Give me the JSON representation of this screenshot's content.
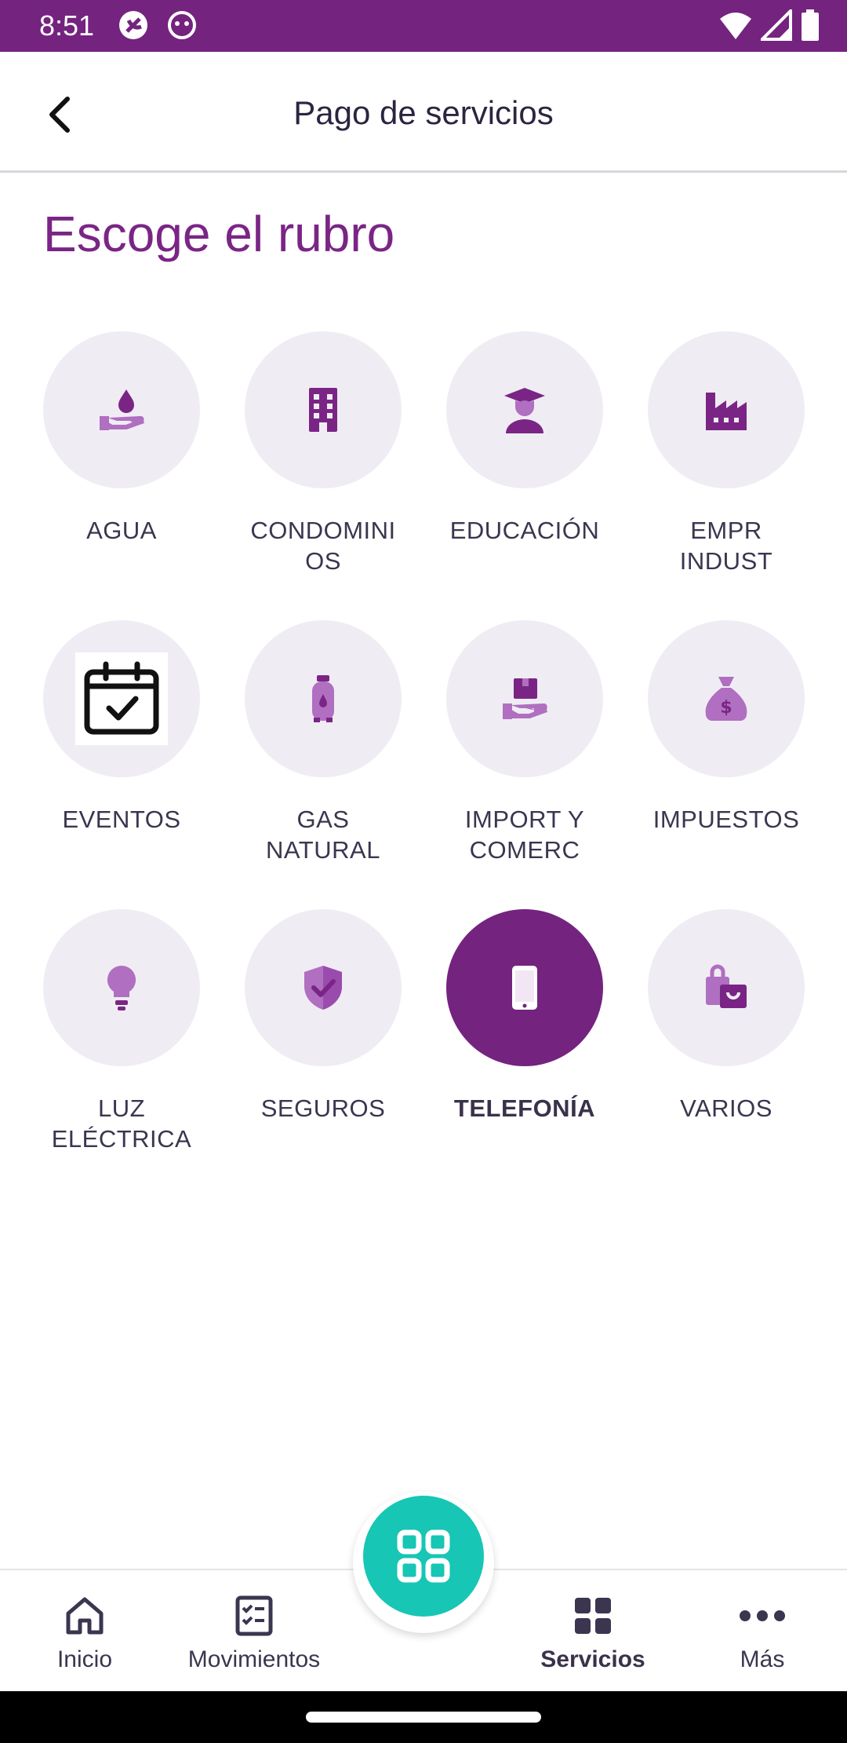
{
  "status_bar": {
    "time": "8:51",
    "icons": [
      "app-icon-1",
      "app-icon-2",
      "wifi-icon",
      "signal-icon",
      "battery-icon"
    ]
  },
  "header": {
    "title": "Pago de servicios",
    "back_icon": "chevron-left-icon"
  },
  "heading": "Escoge el rubro",
  "categories": [
    {
      "label": "AGUA",
      "icon": "water-hand-icon"
    },
    {
      "label": "CONDOMINI\nOS",
      "icon": "building-icon"
    },
    {
      "label": "EDUCACIÓN",
      "icon": "graduate-icon"
    },
    {
      "label": "EMPR\nINDUST",
      "icon": "factory-icon"
    },
    {
      "label": "EVENTOS",
      "icon": "calendar-check-icon"
    },
    {
      "label": "GAS\nNATURAL",
      "icon": "gas-cylinder-icon"
    },
    {
      "label": "IMPORT Y\nCOMERC",
      "icon": "package-hand-icon"
    },
    {
      "label": "IMPUESTOS",
      "icon": "money-bag-icon"
    },
    {
      "label": "LUZ\nELÉCTRICA",
      "icon": "lightbulb-icon"
    },
    {
      "label": "SEGUROS",
      "icon": "shield-check-icon"
    },
    {
      "label": "TELEFONÍA",
      "icon": "smartphone-icon",
      "selected": true
    },
    {
      "label": "VARIOS",
      "icon": "shopping-bag-icon"
    }
  ],
  "bottom_nav": {
    "items": [
      {
        "label": "Inicio",
        "icon": "home-icon"
      },
      {
        "label": "Movimientos",
        "icon": "checklist-icon"
      },
      {
        "label": "Servicios",
        "icon": "grid-icon",
        "active": true
      },
      {
        "label": "Más",
        "icon": "more-dots-icon"
      }
    ],
    "fab_icon": "qr-grid-icon"
  },
  "colors": {
    "primary": "#74237f",
    "icon_purple": "#7a2585",
    "icon_light": "#b06fc0",
    "circle_bg": "#efedf3",
    "fab": "#17c6b4"
  }
}
